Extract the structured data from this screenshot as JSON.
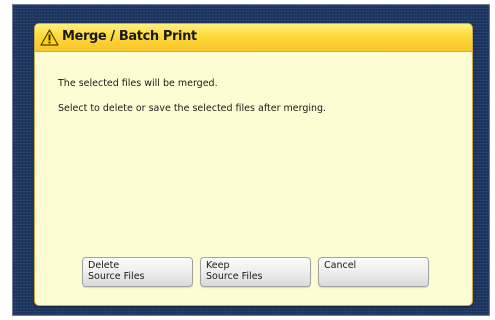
{
  "dialog": {
    "title": "Merge / Batch Print",
    "icon": "warning-triangle-icon",
    "message_line1": "The selected files will be merged.",
    "message_line2": "Select to delete or save the selected files after merging."
  },
  "buttons": {
    "delete": {
      "line1": "Delete",
      "line2": "Source Files"
    },
    "keep": {
      "line1": "Keep",
      "line2": "Source Files"
    },
    "cancel": {
      "label": "Cancel"
    }
  },
  "colors": {
    "screen_background": "#1f3763",
    "dialog_background": "#fefcd3",
    "titlebar": "#ffd93a",
    "button": "#ececec"
  }
}
